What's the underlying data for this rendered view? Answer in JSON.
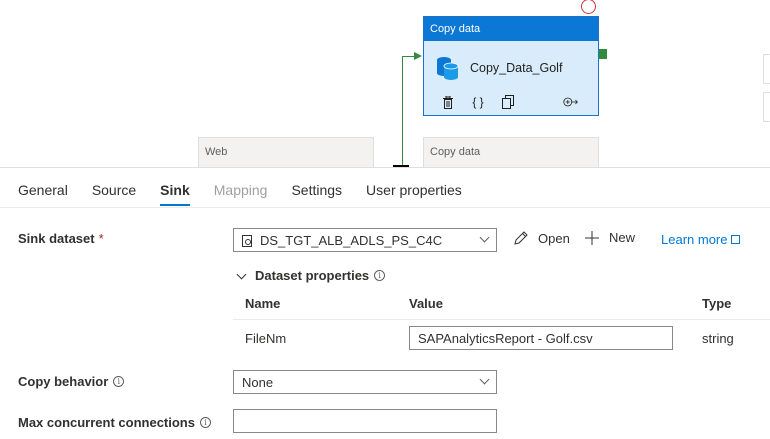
{
  "canvas": {
    "activity_type": "Copy data",
    "activity_name": "Copy_Data_Golf",
    "ghost_nodes": [
      "Web",
      "Copy data"
    ]
  },
  "tabs": [
    {
      "label": "General",
      "state": "normal"
    },
    {
      "label": "Source",
      "state": "normal"
    },
    {
      "label": "Sink",
      "state": "active"
    },
    {
      "label": "Mapping",
      "state": "disabled"
    },
    {
      "label": "Settings",
      "state": "normal"
    },
    {
      "label": "User properties",
      "state": "normal"
    }
  ],
  "sink": {
    "dataset_label": "Sink dataset",
    "required_mark": "*",
    "dataset_value": "DS_TGT_ALB_ADLS_PS_C4C",
    "open_label": "Open",
    "new_label": "New",
    "learn_more_label": "Learn more"
  },
  "dataset_properties": {
    "title": "Dataset properties",
    "columns": [
      "Name",
      "Value",
      "Type"
    ],
    "rows": [
      {
        "name": "FileNm",
        "value": "SAPAnalyticsReport - Golf.csv",
        "type": "string"
      }
    ]
  },
  "copy_behavior": {
    "label": "Copy behavior",
    "value": "None"
  },
  "max_connections": {
    "label": "Max concurrent connections",
    "value": ""
  },
  "colors": {
    "accent": "#0078d4",
    "node_header": "#0a78d4",
    "node_body": "#d9ecfb",
    "success": "#338a3e",
    "error": "#d13438"
  }
}
